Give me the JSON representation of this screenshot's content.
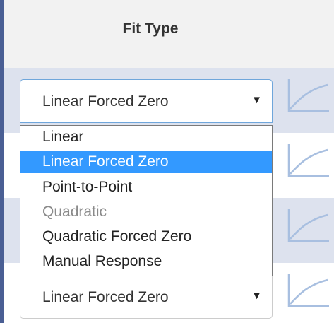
{
  "header": {
    "title": "Fit Type"
  },
  "rows": [
    {
      "select_value": "Linear Forced Zero",
      "shaded": true
    },
    {
      "shaded": false
    },
    {
      "shaded": true
    },
    {
      "select_value": "Linear Forced Zero",
      "shaded": false
    }
  ],
  "dropdown": {
    "options": [
      {
        "label": "Linear",
        "state": "normal"
      },
      {
        "label": "Linear Forced Zero",
        "state": "selected"
      },
      {
        "label": "Point-to-Point",
        "state": "normal"
      },
      {
        "label": "Quadratic",
        "state": "disabled"
      },
      {
        "label": "Quadratic Forced Zero",
        "state": "normal"
      },
      {
        "label": "Manual Response",
        "state": "normal"
      }
    ]
  },
  "icons": {
    "dropdown_arrow": "triangle-down-icon",
    "curve": "calibration-curve-icon"
  },
  "colors": {
    "accent_border": "#4a5f94",
    "row_shade": "#dde2ee",
    "selected_option": "#3399ff",
    "curve_stroke": "#a8bfe0",
    "focus_border": "#6fa6db"
  }
}
